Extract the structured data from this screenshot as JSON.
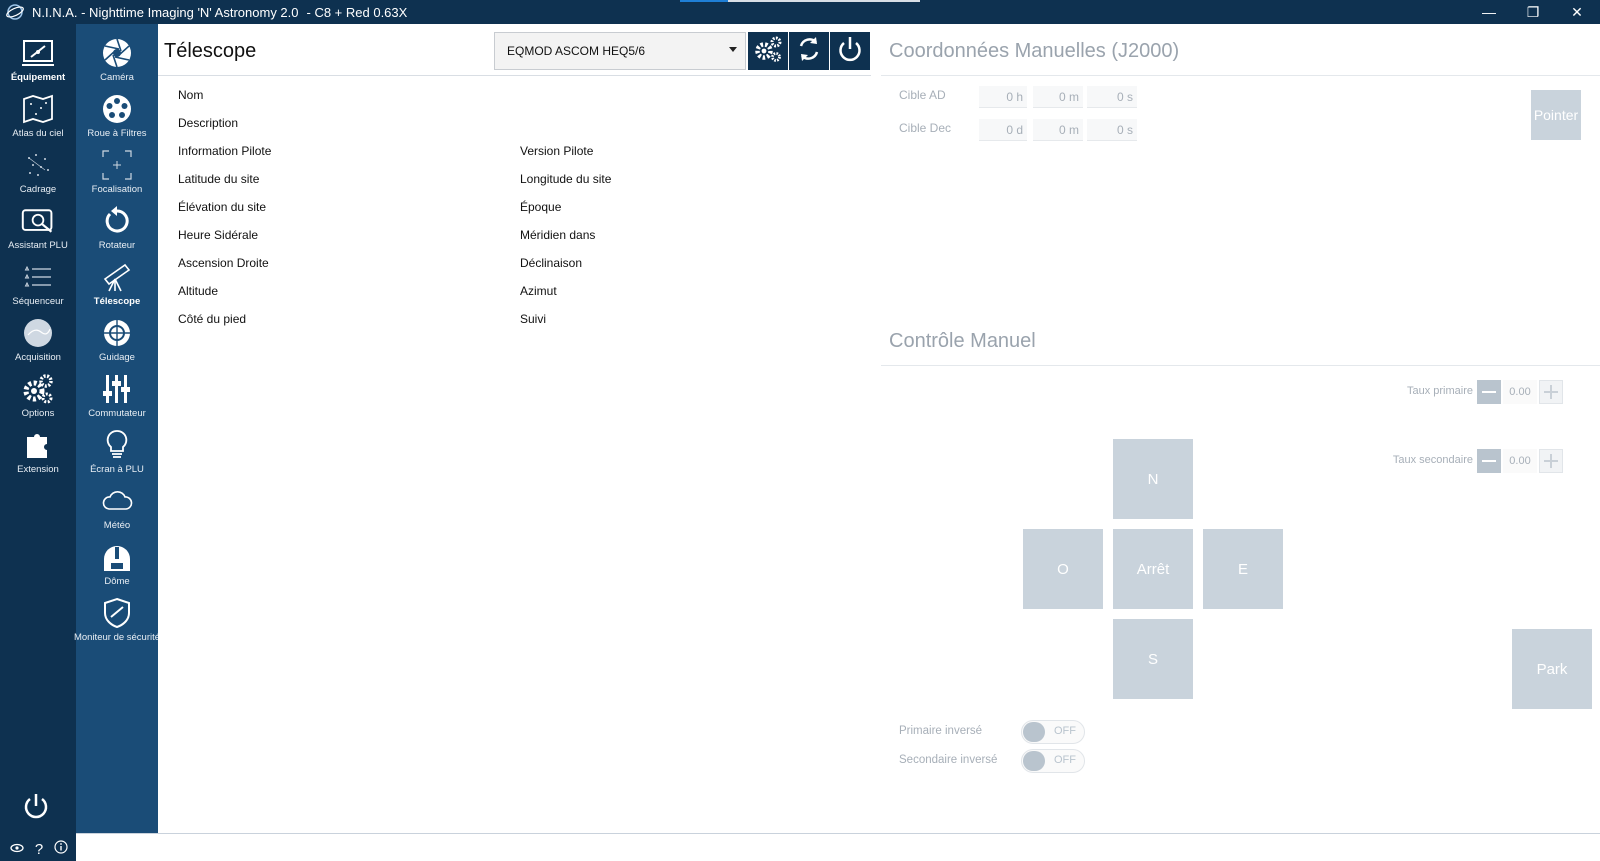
{
  "window": {
    "title": "N.I.N.A. - Nighttime Imaging 'N' Astronomy 2.0",
    "profile": "-   C8 + Red 0.63X",
    "controls": {
      "minimize": "—",
      "maximize": "❐",
      "close": "✕"
    }
  },
  "nav_primary": [
    {
      "label": "Équipement",
      "icon": "equipment-icon",
      "active": true
    },
    {
      "label": "Atlas du ciel",
      "icon": "sky-atlas-icon",
      "active": false
    },
    {
      "label": "Cadrage",
      "icon": "framing-icon",
      "active": false
    },
    {
      "label": "Assistant PLU",
      "icon": "flat-wizard-icon",
      "active": false
    },
    {
      "label": "Séquenceur",
      "icon": "sequencer-icon",
      "active": false
    },
    {
      "label": "Acquisition",
      "icon": "imaging-icon",
      "active": false
    },
    {
      "label": "Options",
      "icon": "options-icon",
      "active": false
    },
    {
      "label": "Extension",
      "icon": "plugin-icon",
      "active": false
    }
  ],
  "nav_equipment": [
    {
      "label": "Caméra",
      "icon": "camera-icon",
      "active": false
    },
    {
      "label": "Roue à Filtres",
      "icon": "filter-wheel-icon",
      "active": false
    },
    {
      "label": "Focalisation",
      "icon": "focuser-icon",
      "active": false
    },
    {
      "label": "Rotateur",
      "icon": "rotator-icon",
      "active": false
    },
    {
      "label": "Télescope",
      "icon": "telescope-icon",
      "active": true
    },
    {
      "label": "Guidage",
      "icon": "guider-icon",
      "active": false
    },
    {
      "label": "Commutateur",
      "icon": "switch-icon",
      "active": false
    },
    {
      "label": "Écran à PLU",
      "icon": "flat-panel-icon",
      "active": false
    },
    {
      "label": "Météo",
      "icon": "weather-icon",
      "active": false
    },
    {
      "label": "Dôme",
      "icon": "dome-icon",
      "active": false
    },
    {
      "label": "Moniteur de sécurité",
      "icon": "safety-monitor-icon",
      "active": false
    }
  ],
  "telescope": {
    "title": "Télescope",
    "selected_device": "EQMOD ASCOM HEQ5/6",
    "properties_left": [
      "Nom",
      "Description",
      "Information Pilote",
      "Latitude du site",
      "Élévation du site",
      "Heure Sidérale",
      "Ascension Droite",
      "Altitude",
      "Côté du pied"
    ],
    "properties_right": [
      "Version Pilote",
      "Longitude du site",
      "Époque",
      "Méridien dans",
      "Déclinaison",
      "Azimut",
      "Suivi"
    ]
  },
  "manual_coords": {
    "title": "Coordonnées Manuelles (J2000)",
    "ra_label": "Cible AD",
    "ra_values": [
      "0 h",
      "0 m",
      "0 s"
    ],
    "dec_label": "Cible Dec",
    "dec_values": [
      "0 d",
      "0 m",
      "0 s"
    ],
    "slew_button": "Pointer"
  },
  "manual_control": {
    "title": "Contrôle Manuel",
    "primary_rate_label": "Taux primaire",
    "primary_rate_value": "0.00",
    "secondary_rate_label": "Taux secondaire",
    "secondary_rate_value": "0.00",
    "north": "N",
    "west": "O",
    "stop": "Arrêt",
    "east": "E",
    "south": "S",
    "park": "Park",
    "primary_reversed_label": "Primaire inversé",
    "primary_reversed_state": "OFF",
    "secondary_reversed_label": "Secondaire inversé",
    "secondary_reversed_state": "OFF"
  },
  "colors": {
    "nav_dark": "#0e3150",
    "nav_mid": "#1a4c77",
    "accent": "#1f7fd6",
    "disabled": "#c9d3dc"
  }
}
